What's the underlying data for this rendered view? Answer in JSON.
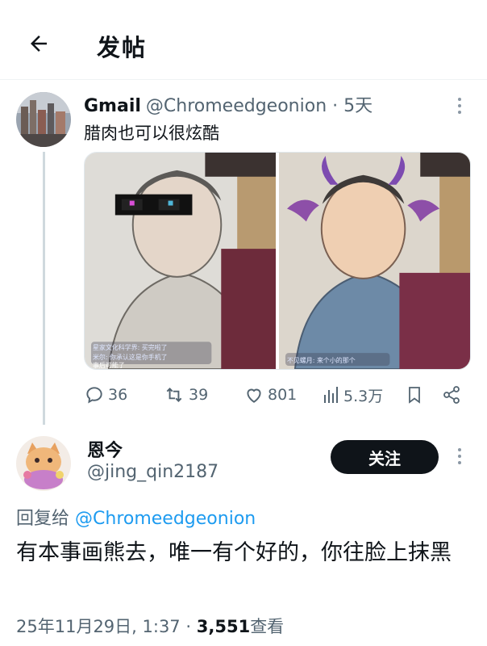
{
  "header": {
    "title": "发帖"
  },
  "quoted_tweet": {
    "name": "Gmail",
    "handle": "@Chromeedgeonion",
    "separator": "·",
    "time": "5天",
    "text": "腊肉也可以很炫酷",
    "media": [
      {
        "overlay_lines": [
          "星家文化科学界: 买完啦了",
          "米尔: 你承认这是你手机了"
        ],
        "footer": "事后可能了"
      },
      {
        "overlay_lines": [
          "不见螺月: 来个小的那个"
        ]
      }
    ],
    "stats": {
      "replies": "36",
      "reposts": "39",
      "likes": "801",
      "views": "5.3万"
    }
  },
  "reply": {
    "name": "恩今",
    "handle": "@jing_qin2187",
    "follow_label": "关注",
    "reply_to_label": "回复给",
    "reply_to_handle": "@Chromeedgeonion",
    "text": "有本事画熊去，唯一有个好的，你往脸上抹黑",
    "date": "25年11月29日, 1:37",
    "separator": "·",
    "views": "3,551",
    "views_label": "查看"
  },
  "colors": {
    "text_primary": "#0f1419",
    "text_secondary": "#536471",
    "link": "#1d9bf0",
    "divider": "#eff3f4",
    "follow_bg": "#0f1419"
  },
  "icons": [
    "back-arrow-icon",
    "more-icon",
    "reply-icon",
    "repost-icon",
    "like-icon",
    "views-icon",
    "bookmark-icon",
    "share-icon"
  ]
}
